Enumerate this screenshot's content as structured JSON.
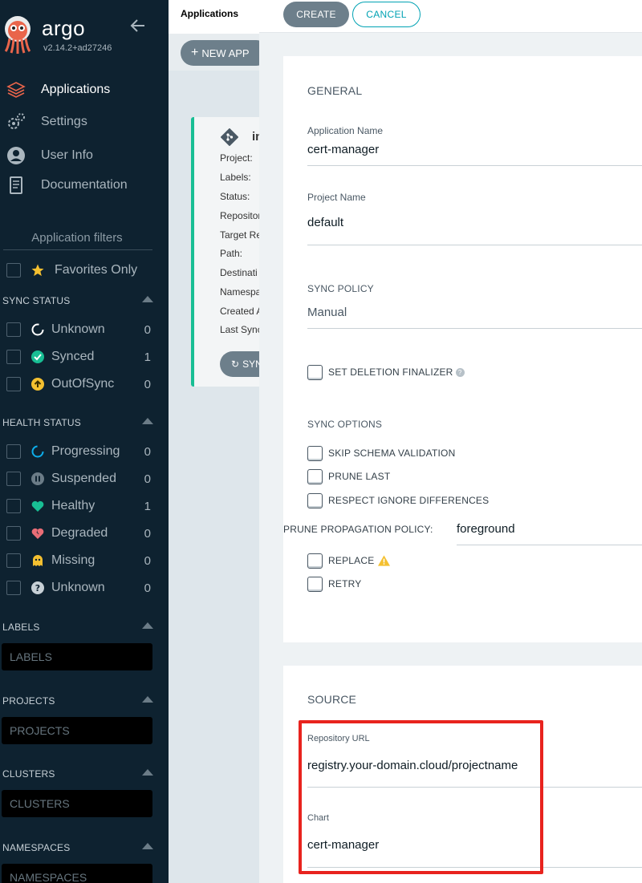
{
  "sidebar": {
    "brand": {
      "name": "argo",
      "version": "v2.14.2+ad27246"
    },
    "nav": [
      {
        "label": "Applications",
        "icon": "layers-icon",
        "active": true
      },
      {
        "label": "Settings",
        "icon": "gears-icon",
        "active": false
      },
      {
        "label": "User Info",
        "icon": "user-circle-icon",
        "active": false
      },
      {
        "label": "Documentation",
        "icon": "book-icon",
        "active": false
      }
    ],
    "filters_title": "Application filters",
    "favorites_label": "Favorites Only",
    "sync_status": {
      "title": "SYNC STATUS",
      "items": [
        {
          "label": "Unknown",
          "count": "0",
          "icon": "circle-notch-icon"
        },
        {
          "label": "Synced",
          "count": "1",
          "icon": "check-circle-icon"
        },
        {
          "label": "OutOfSync",
          "count": "0",
          "icon": "arrow-up-circle-icon"
        }
      ]
    },
    "health_status": {
      "title": "HEALTH STATUS",
      "items": [
        {
          "label": "Progressing",
          "count": "0",
          "icon": "spinner-icon"
        },
        {
          "label": "Suspended",
          "count": "0",
          "icon": "pause-circle-icon"
        },
        {
          "label": "Healthy",
          "count": "1",
          "icon": "heart-icon"
        },
        {
          "label": "Degraded",
          "count": "0",
          "icon": "broken-heart-icon"
        },
        {
          "label": "Missing",
          "count": "0",
          "icon": "ghost-icon"
        },
        {
          "label": "Unknown",
          "count": "0",
          "icon": "question-circle-icon"
        }
      ]
    },
    "labels": {
      "title": "LABELS",
      "placeholder": "LABELS"
    },
    "projects": {
      "title": "PROJECTS",
      "placeholder": "PROJECTS"
    },
    "clusters": {
      "title": "CLUSTERS",
      "placeholder": "CLUSTERS"
    },
    "namespaces": {
      "title": "NAMESPACES",
      "placeholder": "NAMESPACES"
    }
  },
  "apps_page": {
    "breadcrumb": "Applications",
    "new_app_label": "NEW APP",
    "card": {
      "title": "in",
      "fields": [
        "Project:",
        "Labels:",
        "Status:",
        "Repositor",
        "Target Re",
        "Path:",
        "Destinati",
        "Namespa",
        "Created A",
        "Last Sync"
      ],
      "sync_label": "SYN"
    }
  },
  "panel": {
    "create_label": "CREATE",
    "cancel_label": "CANCEL",
    "general": {
      "heading": "GENERAL",
      "app_name_label": "Application Name",
      "app_name_value": "cert-manager",
      "project_label": "Project Name",
      "project_value": "default",
      "sync_policy_label": "SYNC POLICY",
      "sync_policy_value": "Manual",
      "deletion_finalizer_label": "SET DELETION FINALIZER",
      "sync_options_label": "SYNC OPTIONS",
      "sync_options": [
        "SKIP SCHEMA VALIDATION",
        "PRUNE LAST",
        "RESPECT IGNORE DIFFERENCES"
      ],
      "prune_policy_label": "PRUNE PROPAGATION POLICY:",
      "prune_policy_value": "foreground",
      "replace_label": "REPLACE",
      "retry_label": "RETRY"
    },
    "source": {
      "heading": "SOURCE",
      "repo_url_label": "Repository URL",
      "repo_url_value": "registry.your-domain.cloud/projectname",
      "chart_label": "Chart",
      "chart_value": "cert-manager"
    }
  },
  "colors": {
    "sidebar_bg": "#0e2230",
    "accent_teal": "#00a2b3",
    "synced_green": "#18be94",
    "outofsync_yellow": "#f4c030",
    "degraded_red": "#e96d76",
    "highlight_red": "#e8231e"
  }
}
